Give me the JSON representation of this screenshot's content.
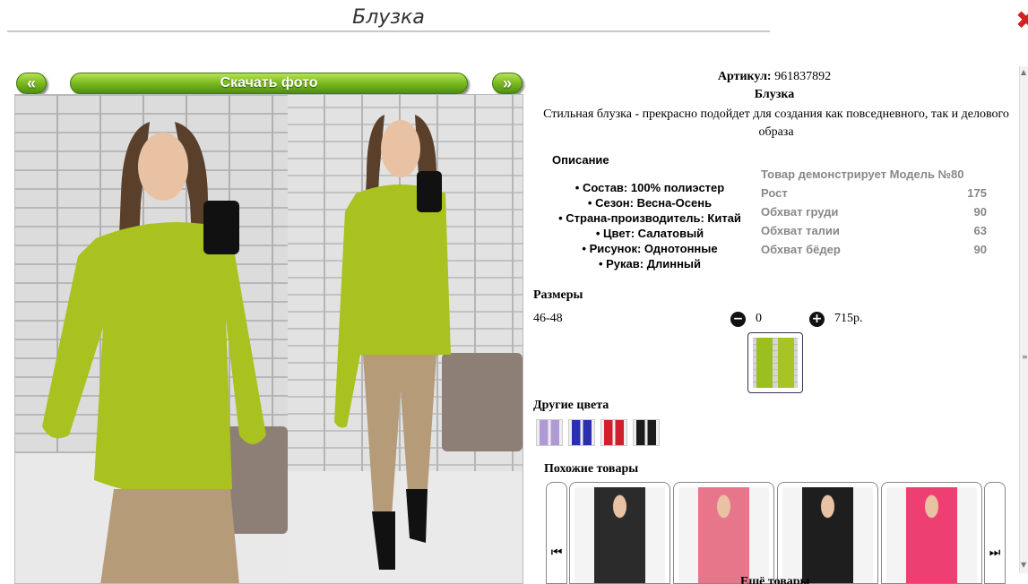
{
  "header": {
    "title": "Блузка",
    "close_icon": "close-x-icon"
  },
  "gallery": {
    "prev_label": "«",
    "download_label": "Скачать фото",
    "next_label": "»",
    "photo_colors": {
      "blouse": "#a9c21f",
      "pants": "#b59b78",
      "hair": "#5a3f2a"
    }
  },
  "product": {
    "article_label": "Артикул:",
    "article_value": "961837892",
    "name": "Блузка",
    "description": "Стильная блузка - прекрасно подойдет для создания как повседневного, так и делового образа"
  },
  "specs": {
    "title": "Описание",
    "items": [
      "Состав: 100% полиэстер",
      "Сезон: Весна-Осень",
      "Страна-производитель: Китай",
      "Цвет: Салатовый",
      "Рисунок: Однотонные",
      "Рукав: Длинный"
    ]
  },
  "model": {
    "heading": "Товар демонстрирует Модель №80",
    "rows": [
      {
        "label": "Рост",
        "value": "175"
      },
      {
        "label": "Обхват груди",
        "value": "90"
      },
      {
        "label": "Обхват талии",
        "value": "63"
      },
      {
        "label": "Обхват бёдер",
        "value": "90"
      }
    ]
  },
  "sizes": {
    "title": "Размеры",
    "size": "46-48",
    "quantity": "0",
    "price": "715р.",
    "minus_icon": "minus-circle-icon",
    "plus_icon": "plus-circle-icon"
  },
  "other_colors": {
    "title": "Другие цвета",
    "swatches": [
      "#b09ad6",
      "#2a2fb0",
      "#d01e2c",
      "#1b1b1b"
    ]
  },
  "similar": {
    "title": "Похожие товары",
    "prev_icon": "skip-prev-icon",
    "next_icon": "skip-next-icon",
    "cards": [
      "#2b2b2b",
      "#e8768a",
      "#1e1e1e",
      "#ee3f72"
    ],
    "more_label": "Ещё товары"
  },
  "accent_color": "#7fbd22"
}
